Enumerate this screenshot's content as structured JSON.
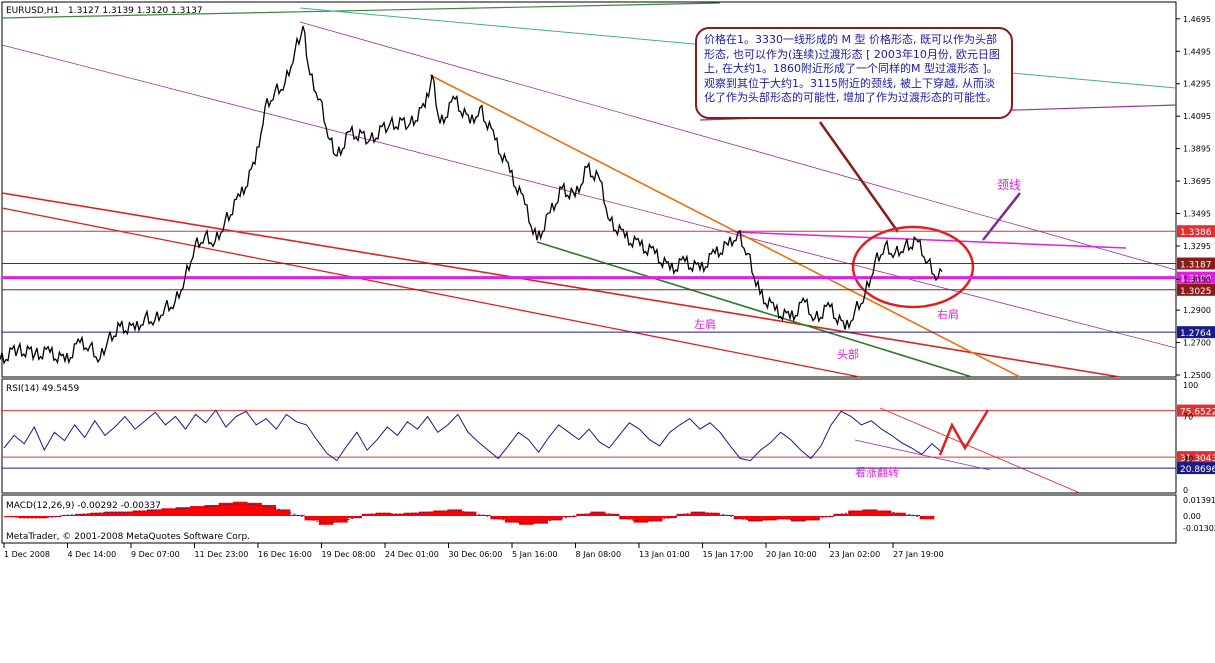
{
  "chart_data": [
    {
      "type": "candlestick",
      "title": "EURUSD,H1",
      "ohlc": "1.3127 1.3139 1.3120 1.3137",
      "ylim": [
        1.25,
        1.47
      ],
      "y_ticks": [
        "1.4695",
        "1.4495",
        "1.4295",
        "1.4095",
        "1.3895",
        "1.3695",
        "1.3495",
        "1.3295",
        "1.3090",
        "1.2900",
        "1.2700",
        "1.2500"
      ],
      "x_ticks": [
        "1 Dec 2008",
        "4 Dec 14:00",
        "9 Dec 07:00",
        "11 Dec 23:00",
        "16 Dec 16:00",
        "19 Dec 08:00",
        "24 Dec 01:00",
        "30 Dec 06:00",
        "5 Jan 16:00",
        "8 Jan 08:00",
        "13 Jan 01:00",
        "15 Jan 17:00",
        "20 Jan 10:00",
        "23 Jan 02:00",
        "27 Jan 19:00"
      ],
      "price_path": [
        [
          0,
          1.2595
        ],
        [
          18,
          1.266
        ],
        [
          35,
          1.263
        ],
        [
          50,
          1.264
        ],
        [
          65,
          1.2585
        ],
        [
          80,
          1.27
        ],
        [
          90,
          1.268
        ],
        [
          100,
          1.26
        ],
        [
          108,
          1.272
        ],
        [
          120,
          1.28
        ],
        [
          135,
          1.278
        ],
        [
          145,
          1.286
        ],
        [
          155,
          1.284
        ],
        [
          165,
          1.292
        ],
        [
          175,
          1.295
        ],
        [
          185,
          1.31
        ],
        [
          195,
          1.33
        ],
        [
          205,
          1.336
        ],
        [
          215,
          1.332
        ],
        [
          225,
          1.345
        ],
        [
          240,
          1.36
        ],
        [
          255,
          1.38
        ],
        [
          265,
          1.415
        ],
        [
          275,
          1.425
        ],
        [
          285,
          1.43
        ],
        [
          295,
          1.45
        ],
        [
          303,
          1.465
        ],
        [
          310,
          1.435
        ],
        [
          320,
          1.42
        ],
        [
          330,
          1.395
        ],
        [
          337,
          1.385
        ],
        [
          350,
          1.4
        ],
        [
          370,
          1.395
        ],
        [
          390,
          1.405
        ],
        [
          410,
          1.405
        ],
        [
          425,
          1.415
        ],
        [
          432,
          1.435
        ],
        [
          440,
          1.405
        ],
        [
          455,
          1.42
        ],
        [
          470,
          1.405
        ],
        [
          480,
          1.415
        ],
        [
          495,
          1.395
        ],
        [
          510,
          1.375
        ],
        [
          525,
          1.355
        ],
        [
          537,
          1.333
        ],
        [
          550,
          1.35
        ],
        [
          562,
          1.365
        ],
        [
          575,
          1.36
        ],
        [
          587,
          1.378
        ],
        [
          600,
          1.37
        ],
        [
          610,
          1.345
        ],
        [
          625,
          1.335
        ],
        [
          640,
          1.33
        ],
        [
          655,
          1.325
        ],
        [
          670,
          1.315
        ],
        [
          685,
          1.32
        ],
        [
          700,
          1.315
        ],
        [
          715,
          1.325
        ],
        [
          728,
          1.33
        ],
        [
          738,
          1.338
        ],
        [
          748,
          1.325
        ],
        [
          760,
          1.3
        ],
        [
          775,
          1.29
        ],
        [
          790,
          1.285
        ],
        [
          805,
          1.295
        ],
        [
          815,
          1.285
        ],
        [
          830,
          1.292
        ],
        [
          845,
          1.278
        ],
        [
          855,
          1.29
        ],
        [
          865,
          1.3
        ],
        [
          875,
          1.32
        ],
        [
          885,
          1.33
        ],
        [
          895,
          1.325
        ],
        [
          905,
          1.33
        ],
        [
          918,
          1.332
        ],
        [
          928,
          1.32
        ],
        [
          938,
          1.31
        ],
        [
          942,
          1.3137
        ]
      ],
      "horizontal_levels": [
        {
          "value": 1.3386,
          "label": "1.3386",
          "color": "#e03030"
        },
        {
          "value": 1.3187,
          "label": "1.3187",
          "color": "#8b1a1a"
        },
        {
          "value": 1.31,
          "label": "1.3100",
          "color": "#e020e0"
        },
        {
          "value": 1.3025,
          "label": "1.3025",
          "color": "#8b1a1a"
        },
        {
          "value": 1.2764,
          "label": "1.2764",
          "color": "#1a1a8b"
        }
      ],
      "annotations": {
        "neckline": "颈线",
        "left_shoulder": "左肩",
        "head": "头部",
        "right_shoulder": "右肩",
        "note": "价格在1。3330一线形成的 M 型 价格形态, 既可以作为头部形态, 也可以作为(连续)过渡形态 [ 2003年10月份, 欧元日图上, 在大约1。1860附近形成了一个同样的M 型过渡形态 ]。观察到其位于大约1。3115附近的颈线, 被上下穿越, 从而淡化了作为头部形态的可能性, 增加了作为过渡形态的可能性。"
      }
    },
    {
      "type": "line",
      "title": "RSI(14) 49.5459",
      "ylim": [
        0,
        100
      ],
      "y_ticks": [
        "100",
        "70",
        "30",
        "0"
      ],
      "levels": [
        {
          "value": 75.6522,
          "label": "75.6522",
          "color": "#e03030"
        },
        {
          "value": 31.3043,
          "label": "31.3043",
          "color": "#e03030"
        },
        {
          "value": 20.8696,
          "label": "20.8696",
          "color": "#1a1a8b"
        }
      ],
      "annotation": "看涨翻转",
      "values": [
        40,
        52,
        44,
        60,
        38,
        55,
        47,
        62,
        50,
        66,
        52,
        60,
        70,
        58,
        66,
        74,
        62,
        70,
        58,
        72,
        64,
        76,
        60,
        70,
        75,
        62,
        68,
        58,
        72,
        65,
        62,
        48,
        35,
        28,
        42,
        55,
        38,
        48,
        60,
        52,
        65,
        58,
        70,
        55,
        62,
        72,
        55,
        46,
        38,
        30,
        42,
        55,
        48,
        36,
        50,
        62,
        55,
        48,
        58,
        46,
        40,
        52,
        64,
        58,
        48,
        42,
        55,
        62,
        68,
        58,
        64,
        55,
        42,
        30,
        28,
        38,
        45,
        55,
        48,
        38,
        30,
        42,
        62,
        75,
        70,
        62,
        66,
        58,
        52,
        45,
        40,
        34,
        44,
        36
      ]
    },
    {
      "type": "histogram",
      "title": "MACD(12,26,9) -0.00292 -0.00337",
      "y_ticks": [
        "0.01391",
        "0.00",
        "-0.01302"
      ],
      "values": [
        -0.001,
        -0.002,
        -0.002,
        -0.001,
        0.001,
        0.002,
        0.003,
        0.004,
        0.004,
        0.005,
        0.006,
        0.007,
        0.008,
        0.009,
        0.01,
        0.012,
        0.013,
        0.012,
        0.01,
        0.006,
        0.001,
        -0.004,
        -0.008,
        -0.006,
        -0.002,
        0.002,
        0.003,
        0.002,
        0.003,
        0.004,
        0.005,
        0.006,
        0.004,
        0.001,
        -0.003,
        -0.006,
        -0.008,
        -0.007,
        -0.004,
        -0.001,
        0.002,
        0.004,
        0.002,
        -0.003,
        -0.006,
        -0.005,
        -0.002,
        0.002,
        0.004,
        0.003,
        0.001,
        -0.003,
        -0.005,
        -0.004,
        -0.003,
        -0.005,
        -0.004,
        -0.001,
        0.002,
        0.005,
        0.006,
        0.005,
        0.003,
        0.001,
        -0.003
      ]
    }
  ],
  "watermark": "MetaTrader, © 2001-2008 MetaQuotes Software Corp.",
  "colors": {
    "candles": "#000000",
    "rsi": "#1a1a8b",
    "macd": "#ff0000",
    "signal": "#1a1a8b",
    "note_border": "#8b1a1a",
    "note_text": "#1a1aa6",
    "pink": "#e020e0"
  }
}
